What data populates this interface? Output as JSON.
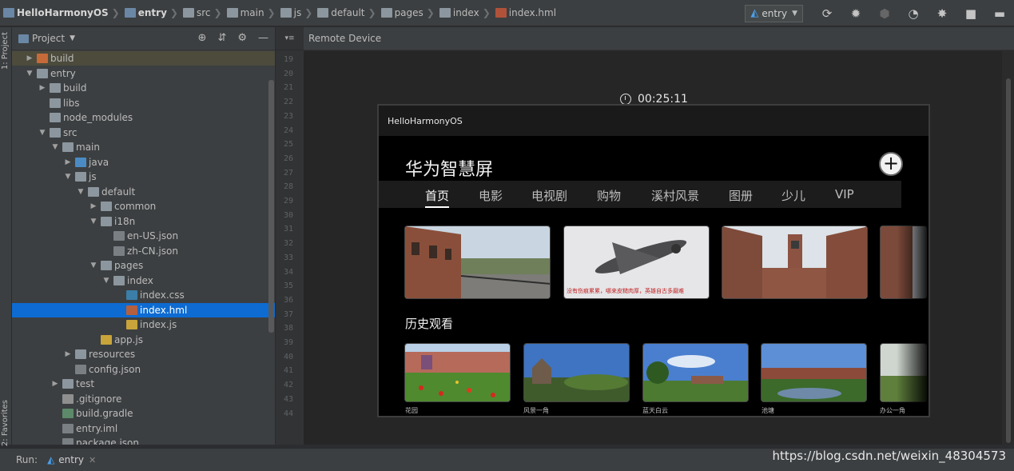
{
  "navbar": {
    "crumbs": [
      "HelloHarmonyOS",
      "entry",
      "src",
      "main",
      "js",
      "default",
      "pages",
      "index",
      "index.hml"
    ],
    "run_config": "entry"
  },
  "side_strip": {
    "project_label": "1: Project",
    "favorites_label": "2: Favorites"
  },
  "project": {
    "title": "Project",
    "tree": [
      {
        "label": "build",
        "depth": 0,
        "arrow": "▶",
        "icon": "fi-folder-orange",
        "state": "highlight"
      },
      {
        "label": "entry",
        "depth": 0,
        "arrow": "▼",
        "icon": "fi-folder",
        "state": ""
      },
      {
        "label": "build",
        "depth": 1,
        "arrow": "▶",
        "icon": "fi-folder",
        "state": ""
      },
      {
        "label": "libs",
        "depth": 1,
        "arrow": "",
        "icon": "fi-folder",
        "state": ""
      },
      {
        "label": "node_modules",
        "depth": 1,
        "arrow": "",
        "icon": "fi-folder",
        "state": ""
      },
      {
        "label": "src",
        "depth": 1,
        "arrow": "▼",
        "icon": "fi-folder",
        "state": ""
      },
      {
        "label": "main",
        "depth": 2,
        "arrow": "▼",
        "icon": "fi-folder",
        "state": ""
      },
      {
        "label": "java",
        "depth": 3,
        "arrow": "▶",
        "icon": "fi-folder-blue",
        "state": ""
      },
      {
        "label": "js",
        "depth": 3,
        "arrow": "▼",
        "icon": "fi-folder",
        "state": ""
      },
      {
        "label": "default",
        "depth": 4,
        "arrow": "▼",
        "icon": "fi-folder",
        "state": ""
      },
      {
        "label": "common",
        "depth": 5,
        "arrow": "▶",
        "icon": "fi-folder",
        "state": ""
      },
      {
        "label": "i18n",
        "depth": 5,
        "arrow": "▼",
        "icon": "fi-folder",
        "state": ""
      },
      {
        "label": "en-US.json",
        "depth": 6,
        "arrow": "",
        "icon": "fi-json",
        "state": ""
      },
      {
        "label": "zh-CN.json",
        "depth": 6,
        "arrow": "",
        "icon": "fi-json",
        "state": ""
      },
      {
        "label": "pages",
        "depth": 5,
        "arrow": "▼",
        "icon": "fi-folder",
        "state": ""
      },
      {
        "label": "index",
        "depth": 6,
        "arrow": "▼",
        "icon": "fi-folder",
        "state": ""
      },
      {
        "label": "index.css",
        "depth": 7,
        "arrow": "",
        "icon": "fi-css",
        "state": ""
      },
      {
        "label": "index.hml",
        "depth": 7,
        "arrow": "",
        "icon": "fi-html",
        "state": "selected"
      },
      {
        "label": "index.js",
        "depth": 7,
        "arrow": "",
        "icon": "fi-js",
        "state": ""
      },
      {
        "label": "app.js",
        "depth": 5,
        "arrow": "",
        "icon": "fi-js",
        "state": ""
      },
      {
        "label": "resources",
        "depth": 3,
        "arrow": "▶",
        "icon": "fi-folder",
        "state": ""
      },
      {
        "label": "config.json",
        "depth": 3,
        "arrow": "",
        "icon": "fi-json",
        "state": ""
      },
      {
        "label": "test",
        "depth": 2,
        "arrow": "▶",
        "icon": "fi-folder",
        "state": ""
      },
      {
        "label": ".gitignore",
        "depth": 2,
        "arrow": "",
        "icon": "fi-git",
        "state": ""
      },
      {
        "label": "build.gradle",
        "depth": 2,
        "arrow": "",
        "icon": "fi-gradle",
        "state": ""
      },
      {
        "label": "entry.iml",
        "depth": 2,
        "arrow": "",
        "icon": "fi-json",
        "state": ""
      },
      {
        "label": "package.json",
        "depth": 2,
        "arrow": "",
        "icon": "fi-json",
        "state": ""
      }
    ]
  },
  "gutter": {
    "lines": [
      "19",
      "20",
      "21",
      "22",
      "23",
      "24",
      "25",
      "26",
      "27",
      "28",
      "29",
      "30",
      "31",
      "32",
      "33",
      "34",
      "35",
      "36",
      "37",
      "38",
      "39",
      "40",
      "41",
      "42",
      "43",
      "44"
    ]
  },
  "remote": {
    "title": "Remote Device",
    "timer": "00:25:11",
    "device": {
      "app_title": "HelloHarmonyOS",
      "heading": "华为智慧屏",
      "add_label": "+",
      "tabs": [
        "首页",
        "电影",
        "电视剧",
        "购物",
        "溪村风景",
        "图册",
        "少儿",
        "VIP"
      ],
      "banner_caption": "没有伤痕累累，哪来皮糙肉厚，英雄自古多磨难",
      "history_title": "历史观看",
      "history_captions": [
        "花园",
        "风景一角",
        "蓝天白云",
        "池塘",
        "办公一角"
      ]
    }
  },
  "runbar": {
    "label": "Run:",
    "tab": "entry",
    "close": "✕"
  },
  "watermark": "https://blog.csdn.net/weixin_48304573"
}
